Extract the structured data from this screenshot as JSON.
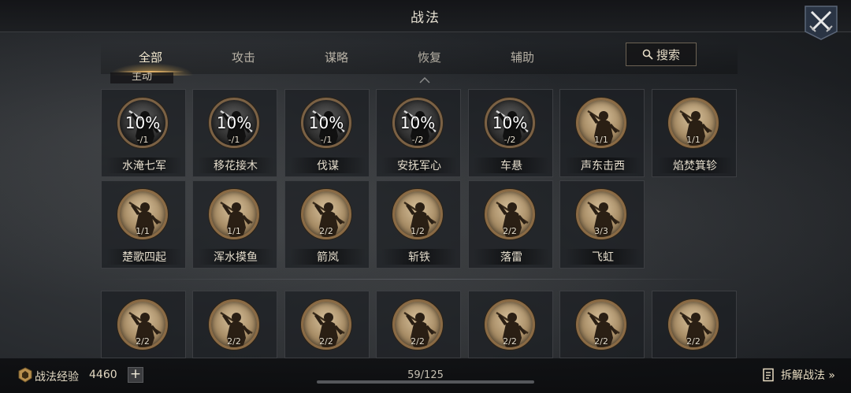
{
  "header": {
    "title": "战法"
  },
  "tabs": [
    {
      "label": "全部",
      "active": true
    },
    {
      "label": "攻击",
      "active": false
    },
    {
      "label": "谋略",
      "active": false
    },
    {
      "label": "恢复",
      "active": false
    },
    {
      "label": "辅助",
      "active": false
    }
  ],
  "search": {
    "label": "搜索",
    "icon": "search-icon"
  },
  "section": {
    "label": "主动"
  },
  "row1": [
    {
      "name": "水淹七军",
      "percent": "10%",
      "level": "-/1",
      "style": "dark"
    },
    {
      "name": "移花接木",
      "percent": "10%",
      "level": "-/1",
      "style": "dark"
    },
    {
      "name": "伐谋",
      "percent": "10%",
      "level": "-/1",
      "style": "dark"
    },
    {
      "name": "安抚军心",
      "percent": "10%",
      "level": "-/2",
      "style": "dark"
    },
    {
      "name": "车悬",
      "percent": "10%",
      "level": "-/2",
      "style": "dark"
    },
    {
      "name": "声东击西",
      "percent": "",
      "level": "1/1",
      "style": "gold"
    },
    {
      "name": "焰焚箕轸",
      "percent": "",
      "level": "1/1",
      "style": "gold"
    }
  ],
  "row2": [
    {
      "name": "楚歌四起",
      "level": "1/1"
    },
    {
      "name": "浑水摸鱼",
      "level": "1/1"
    },
    {
      "name": "箭岚",
      "level": "2/2"
    },
    {
      "name": "斩铁",
      "level": "1/2"
    },
    {
      "name": "落雷",
      "level": "2/2"
    },
    {
      "name": "飞虹",
      "level": "3/3"
    }
  ],
  "row3": [
    {
      "level": "2/2"
    },
    {
      "level": "2/2"
    },
    {
      "level": "2/2"
    },
    {
      "level": "2/2"
    },
    {
      "level": "2/2"
    },
    {
      "level": "2/2"
    },
    {
      "level": "2/2"
    }
  ],
  "footer": {
    "exp_label": "战法经验",
    "exp_value": "4460",
    "plus": "+",
    "page": "59/125",
    "decompose_label": "拆解战法 »"
  },
  "colors": {
    "accent": "#e4b46a",
    "gold_disk": "#a88d66",
    "frame": "#8a6a44"
  }
}
